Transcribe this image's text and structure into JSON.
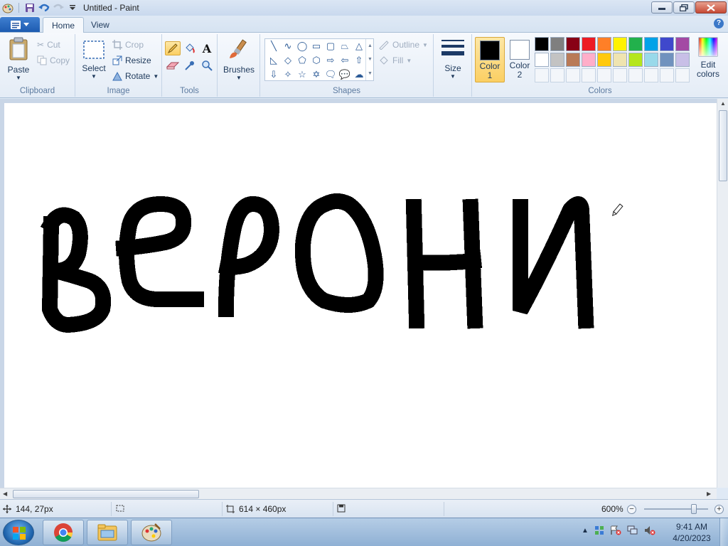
{
  "window": {
    "title": "Untitled - Paint"
  },
  "tabs": [
    {
      "label": "Home",
      "active": true
    },
    {
      "label": "View",
      "active": false
    }
  ],
  "ribbon": {
    "clipboard": {
      "paste": "Paste",
      "cut": "Cut",
      "copy": "Copy",
      "label": "Clipboard"
    },
    "image": {
      "select": "Select",
      "crop": "Crop",
      "resize": "Resize",
      "rotate": "Rotate",
      "label": "Image"
    },
    "tools": {
      "label": "Tools",
      "text_tool_glyph": "A"
    },
    "brushes": {
      "label": "Brushes"
    },
    "shapes": {
      "outline": "Outline",
      "fill": "Fill",
      "label": "Shapes"
    },
    "size": {
      "label": "Size"
    },
    "colors": {
      "color1_label": "Color",
      "color1_num": "1",
      "color2_label": "Color",
      "color2_num": "2",
      "edit_label": "Edit",
      "edit_label2": "colors",
      "label": "Colors",
      "color1_value": "#000000",
      "color2_value": "#ffffff",
      "palette": [
        "#000000",
        "#7f7f7f",
        "#880015",
        "#ed1c24",
        "#ff7f27",
        "#fff200",
        "#22b14c",
        "#00a2e8",
        "#3f48cc",
        "#a349a4",
        "#ffffff",
        "#c3c3c3",
        "#b97a57",
        "#ffaec9",
        "#ffc90e",
        "#efe4b0",
        "#b5e61d",
        "#99d9ea",
        "#7092be",
        "#c8bfe7"
      ]
    }
  },
  "canvas": {
    "drawing_description_icon": "pencil-cursor-icon"
  },
  "status": {
    "cursor_position": "144, 27px",
    "image_size": "614 × 460px",
    "zoom": "600%"
  },
  "taskbar": {
    "time": "9:41 AM",
    "date": "4/20/2023"
  }
}
